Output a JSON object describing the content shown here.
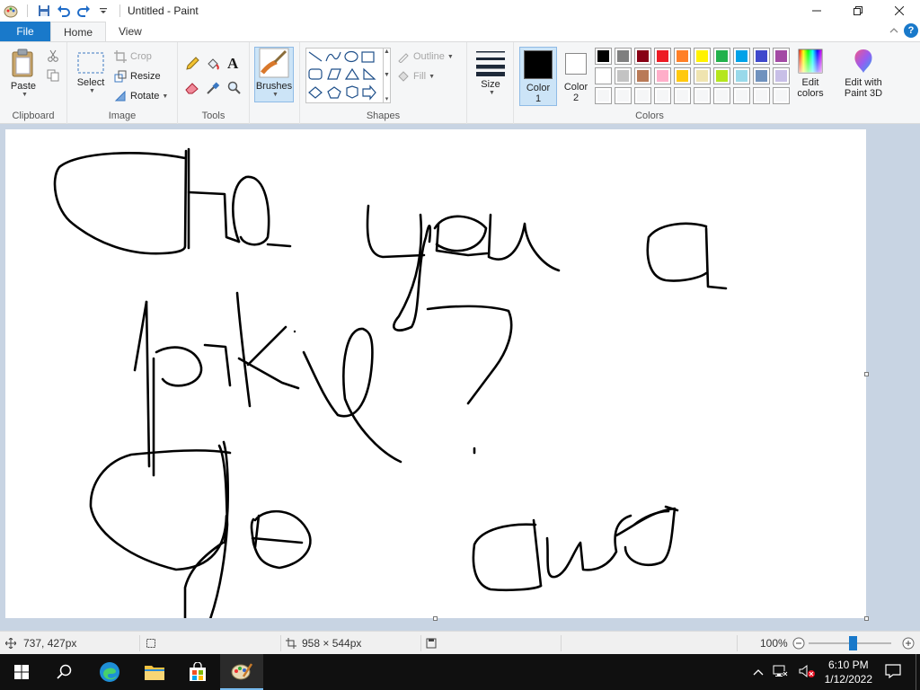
{
  "window": {
    "title": "Untitled - Paint"
  },
  "tabs": {
    "file": "File",
    "home": "Home",
    "view": "View"
  },
  "ribbon": {
    "clipboard": {
      "label": "Clipboard",
      "paste": "Paste"
    },
    "image": {
      "label": "Image",
      "select": "Select",
      "crop": "Crop",
      "resize": "Resize",
      "rotate": "Rotate"
    },
    "tools": {
      "label": "Tools"
    },
    "brushes": "Brushes",
    "shapes": {
      "label": "Shapes",
      "outline": "Outline",
      "fill": "Fill"
    },
    "size": "Size",
    "colors": {
      "label": "Colors",
      "color1_line1": "Color",
      "color1_line2": "1",
      "color2_line1": "Color",
      "color2_line2": "2",
      "color1_value": "#000000",
      "color2_value": "#ffffff",
      "edit_line1": "Edit",
      "edit_line2": "colors",
      "paint3d_line1": "Edit with",
      "paint3d_line2": "Paint 3D",
      "palette": [
        [
          "#000000",
          "#7f7f7f",
          "#880015",
          "#ed1c24",
          "#ff7f27",
          "#fff200",
          "#22b14c",
          "#00a2e8",
          "#3f48cc",
          "#a349a4"
        ],
        [
          "#ffffff",
          "#c3c3c3",
          "#b97a57",
          "#ffaec9",
          "#ffc90e",
          "#efe4b0",
          "#b5e61d",
          "#99d9ea",
          "#7092be",
          "#c8bfe7"
        ],
        [
          "#ffffff",
          "#ffffff",
          "#ffffff",
          "#ffffff",
          "#ffffff",
          "#ffffff",
          "#ffffff",
          "#ffffff",
          "#ffffff",
          "#ffffff"
        ]
      ]
    }
  },
  "status": {
    "cursor_pos": "737, 427px",
    "image_size": "958 × 544px",
    "zoom": "100%"
  },
  "taskbar": {
    "time": "6:10 PM",
    "date": "1/12/2022"
  }
}
